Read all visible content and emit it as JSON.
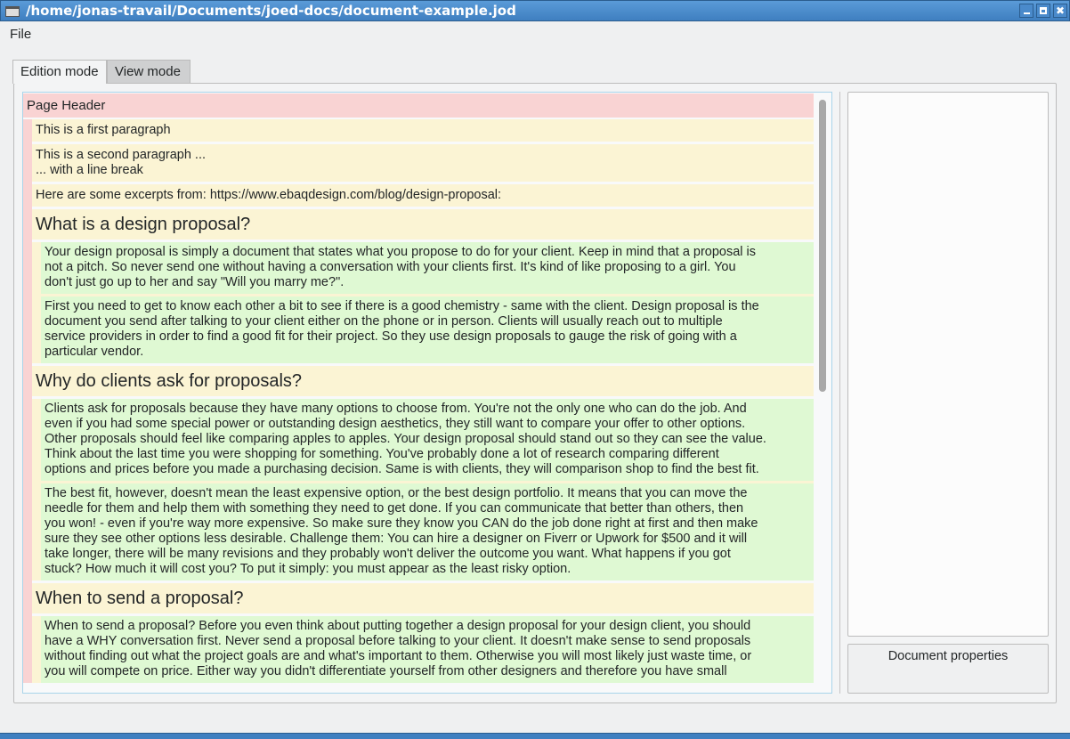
{
  "window": {
    "title": "/home/jonas-travail/Documents/joed-docs/document-example.jod"
  },
  "menu": {
    "file": "File"
  },
  "tabs": [
    {
      "label": "Edition mode"
    },
    {
      "label": "View mode"
    }
  ],
  "document": {
    "page_header": "Page Header",
    "p1": [
      "This is a first paragraph"
    ],
    "p2": [
      "This is a second paragraph ...",
      "... with a line break"
    ],
    "p3": [
      "Here are some excerpts from: https://www.ebaqdesign.com/blog/design-proposal:"
    ],
    "h1": "What is a design proposal?",
    "s1p1": [
      "Your design proposal is simply a document that states what you propose to do for your client. Keep in mind that a proposal is",
      "not a pitch. So never send one without having a conversation with your clients first. It's kind of like proposing to a girl. You",
      "don't just go up to her and say \"Will you marry me?\"."
    ],
    "s1p2": [
      "First you need to get to know each other a bit to see if there is a good chemistry - same with the client. Design proposal is the",
      "document you send after talking to your client either on the phone or in person. Clients will usually reach out to multiple",
      "service providers in order to find a good fit for their project. So they use design proposals to gauge the risk of going with a",
      "particular vendor."
    ],
    "h2": "Why do clients ask for proposals?",
    "s2p1": [
      "Clients ask for proposals because they have many options to choose from. You're not the only one who can do the job. And",
      "even if you had some special power or outstanding design aesthetics, they still want to compare your offer to other options.",
      "Other proposals should feel like comparing apples to apples. Your design proposal should stand out so they can see the value.",
      "Think about the last time you were shopping for something. You've probably done a lot of research comparing different",
      "options and prices before you made a purchasing decision. Same is with clients, they will comparison shop to find the best fit."
    ],
    "s2p2": [
      "The best fit, however, doesn't mean the least expensive option, or the best design portfolio. It means that you can move the",
      "needle for them and help them with something they need to get done. If you can communicate that better than others, then",
      "you won! - even if you're way more expensive. So make sure they know you CAN do the job done right at first and then make",
      "sure they see other options less desirable. Challenge them: You can hire a designer on Fiverr or Upwork for $500 and it will",
      "take longer, there will be many revisions and they probably won't deliver the outcome you want. What happens if you got",
      "stuck? How much it will cost you? To put it simply: you must appear as the least risky option."
    ],
    "h3": "When to send a proposal?",
    "s3p1": [
      "When to send a proposal? Before you even think about putting together a design proposal for your design client, you should",
      "have a WHY conversation first. Never send a proposal before talking to your client. It doesn't make sense to send proposals",
      "without finding out what the project goals are and what's important to them. Otherwise you will most likely just waste time, or",
      "you will compete on price. Either way you didn't differentiate yourself from other designers and therefore you have small"
    ]
  },
  "side": {
    "properties_button": "Document properties"
  }
}
